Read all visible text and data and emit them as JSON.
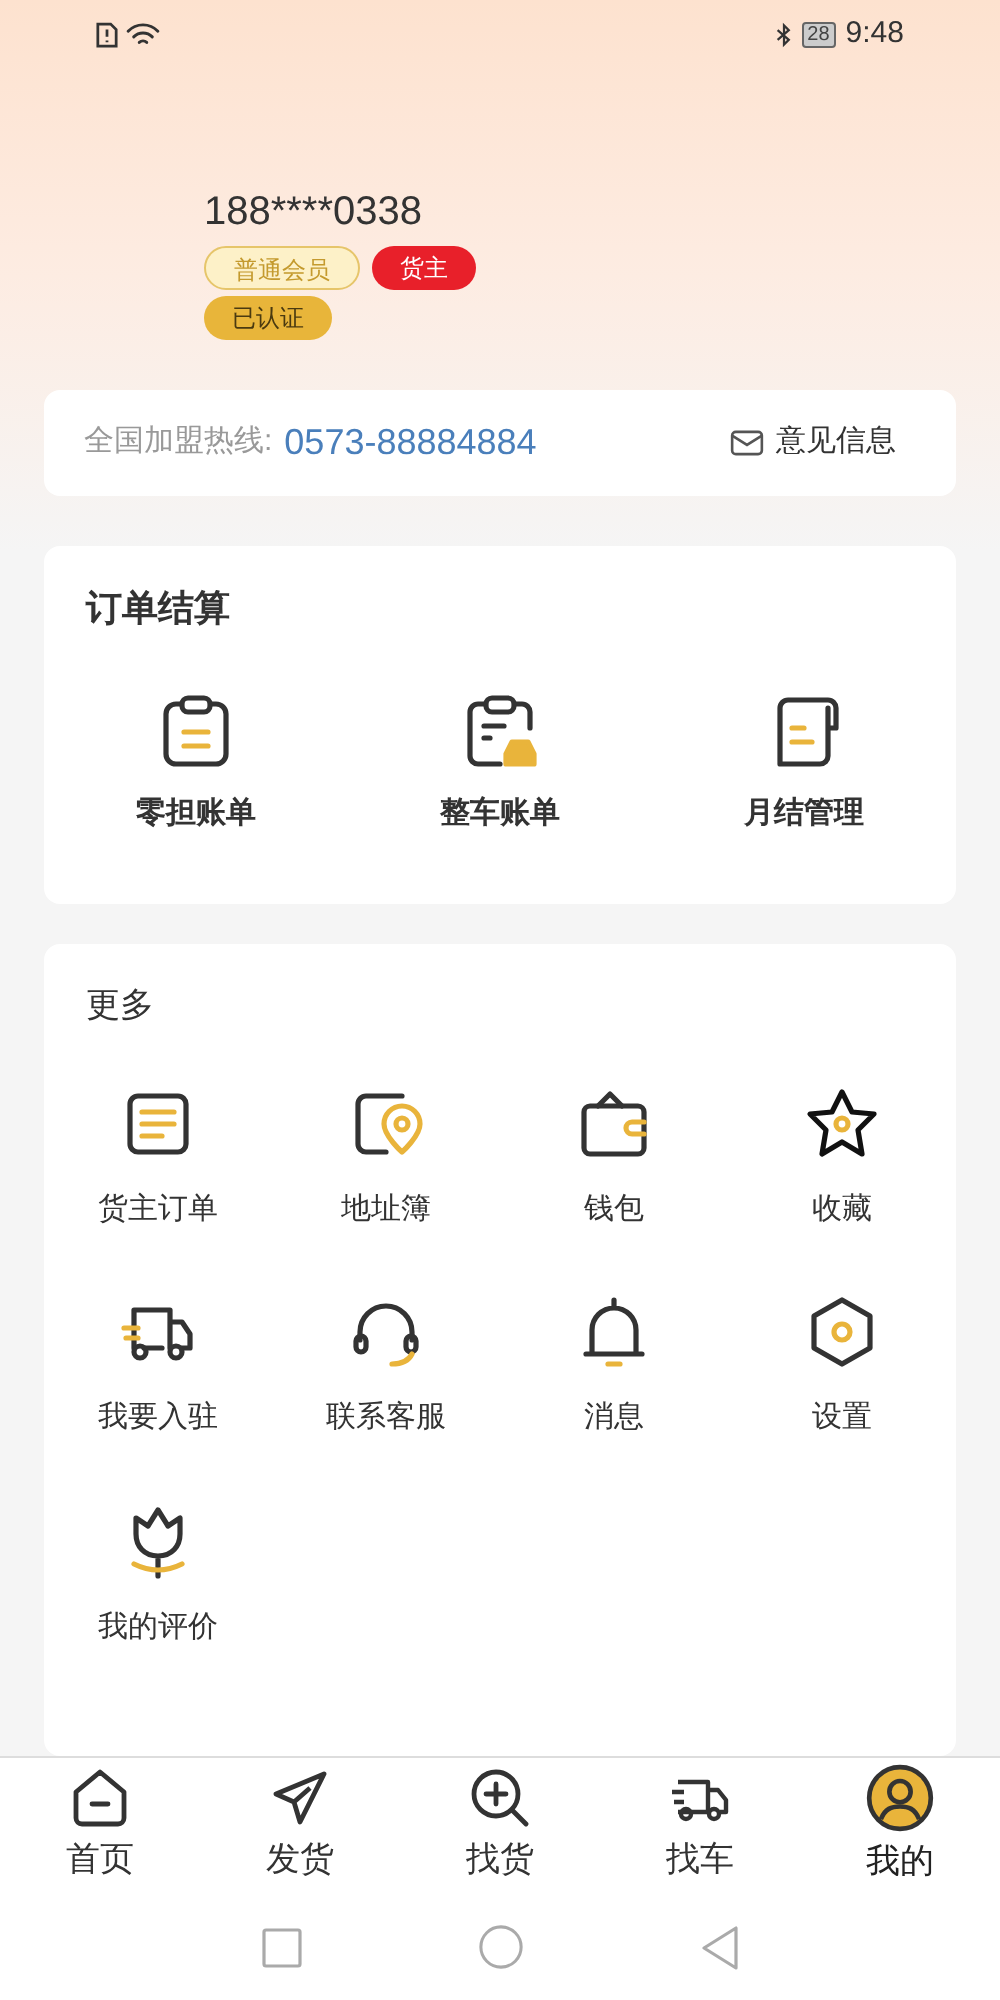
{
  "status_bar": {
    "battery": "28",
    "time": "9:48"
  },
  "profile": {
    "phone": "188****0338",
    "tags": [
      {
        "label": "普通会员",
        "kind": "outline"
      },
      {
        "label": "货主",
        "kind": "red"
      },
      {
        "label": "已认证",
        "kind": "gold"
      }
    ]
  },
  "hotline": {
    "label": "全国加盟热线:",
    "number": "0573-88884884",
    "feedback": "意见信息"
  },
  "order_settlement": {
    "title": "订单结算",
    "items": [
      "零担账单",
      "整车账单",
      "月结管理"
    ]
  },
  "more": {
    "title": "更多",
    "items": [
      "货主订单",
      "地址簿",
      "钱包",
      "收藏",
      "我要入驻",
      "联系客服",
      "消息",
      "设置",
      "我的评价"
    ]
  },
  "tab_bar": [
    {
      "label": "首页",
      "selected": false
    },
    {
      "label": "发货",
      "selected": false
    },
    {
      "label": "找货",
      "selected": false
    },
    {
      "label": "找车",
      "selected": false
    },
    {
      "label": "我的",
      "selected": true
    }
  ]
}
